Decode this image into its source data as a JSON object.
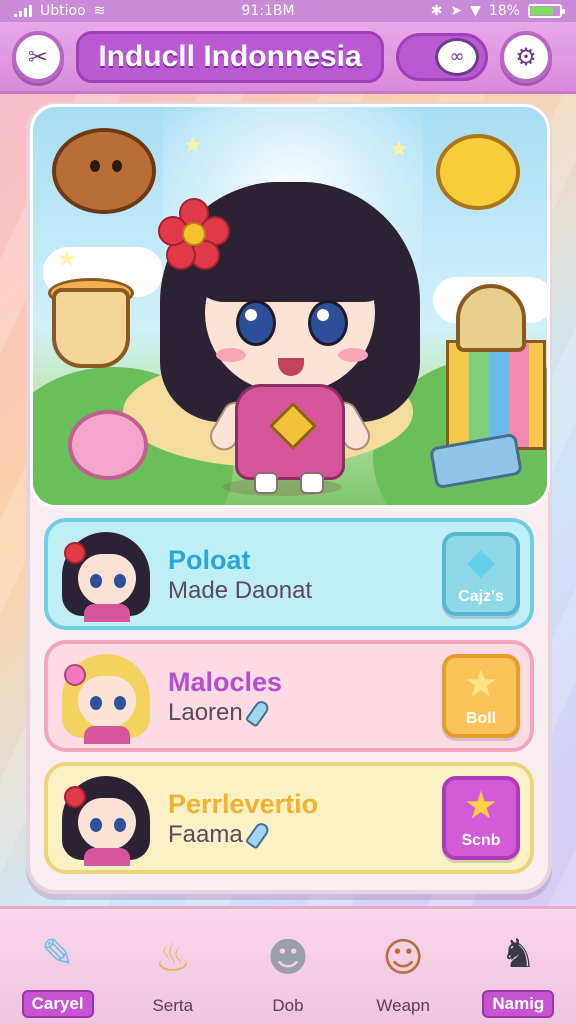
{
  "status_bar": {
    "carrier": "Ubtioo",
    "time": "91:1BM",
    "battery": "18%",
    "battery_level": 0.8
  },
  "header": {
    "title": "Inducll Indonnesia",
    "back_icon": "back-arrow-icon",
    "chat_icon": "chat-bubble-icon",
    "settings_icon": "gear-icon"
  },
  "scene": {
    "character": "chibi-girl",
    "decorations": [
      "cookie-icon",
      "duck-icon",
      "ramen-cup-icon",
      "cupcake-icon",
      "pink-blob-icon",
      "palette-icon"
    ]
  },
  "characters": [
    {
      "name": "Poloat",
      "subtitle": "Made Daonat",
      "button_label": "Cajz's",
      "button_icon": "ice-cream-icon",
      "hair_color": "#2b2233"
    },
    {
      "name": "Malocles",
      "subtitle": "Laoren",
      "button_label": "Boll",
      "button_icon": "star-icon",
      "hair_color": "#f3d35f"
    },
    {
      "name": "Perrlevertio",
      "subtitle": "Faama",
      "button_label": "Scnb",
      "button_icon": "star-icon",
      "hair_color": "#2b2233"
    }
  ],
  "nav": [
    {
      "label": "Caryel",
      "icon": "pencil-icon",
      "active": true
    },
    {
      "label": "Serta",
      "icon": "cupcake-icon",
      "active": false
    },
    {
      "label": "Dob",
      "icon": "ghost-icon",
      "active": false
    },
    {
      "label": "Weapn",
      "icon": "monkey-icon",
      "active": false
    },
    {
      "label": "Namig",
      "icon": "cat-icon",
      "active": true
    }
  ],
  "colors": {
    "header": "#d98ad9",
    "title_pill": "#b95ad2",
    "row_1": "#bfeef7",
    "row_2": "#fcdbe4",
    "row_3": "#fbf1c4",
    "nav_active": "#c653d1"
  }
}
